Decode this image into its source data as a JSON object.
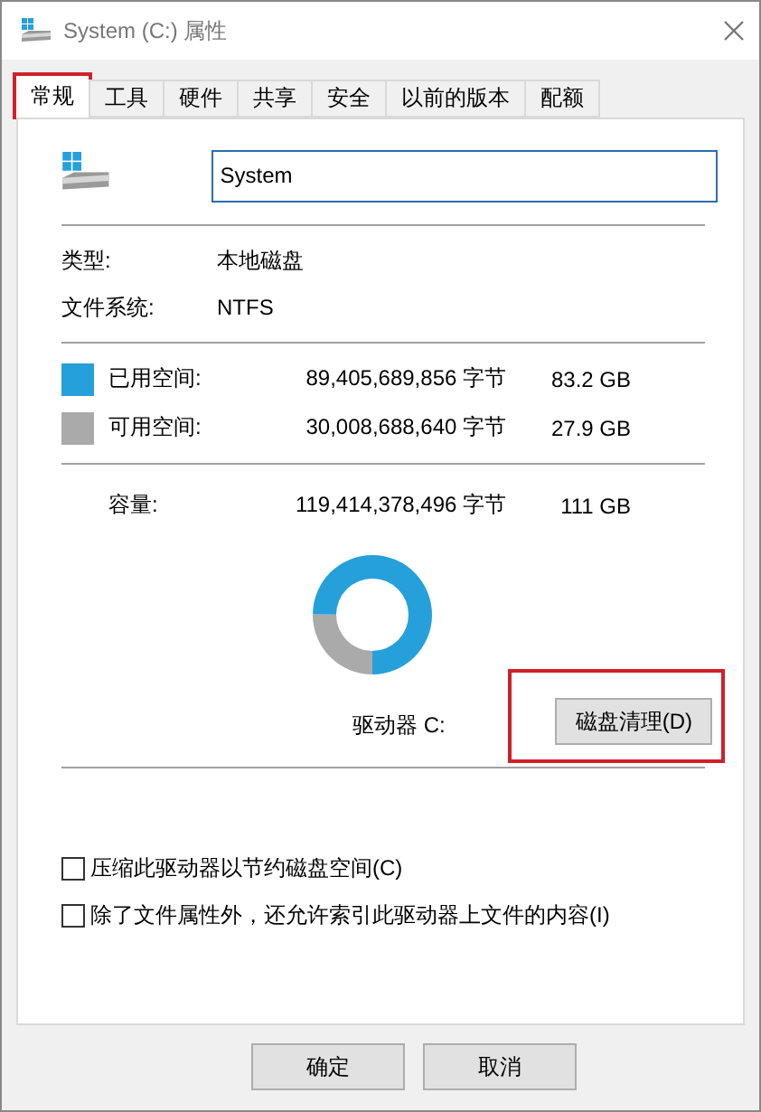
{
  "window": {
    "title": "System (C:) 属性"
  },
  "tabs": [
    {
      "label": "常规",
      "selected": true,
      "highlighted": true
    },
    {
      "label": "工具",
      "selected": false,
      "highlighted": false
    },
    {
      "label": "硬件",
      "selected": false,
      "highlighted": false
    },
    {
      "label": "共享",
      "selected": false,
      "highlighted": false
    },
    {
      "label": "安全",
      "selected": false,
      "highlighted": false
    },
    {
      "label": "以前的版本",
      "selected": false,
      "highlighted": false
    },
    {
      "label": "配额",
      "selected": false,
      "highlighted": false
    }
  ],
  "name_field": {
    "value": "System"
  },
  "info": [
    {
      "label": "类型:",
      "value": "本地磁盘"
    },
    {
      "label": "文件系统:",
      "value": "NTFS"
    }
  ],
  "space": [
    {
      "label": "已用空间:",
      "bytes": "89,405,689,856 字节",
      "size": "83.2 GB",
      "color": "#26a0da"
    },
    {
      "label": "可用空间:",
      "bytes": "30,008,688,640 字节",
      "size": "27.9 GB",
      "color": "#aaaaaa"
    }
  ],
  "capacity": {
    "label": "容量:",
    "bytes": "119,414,378,496 字节",
    "size": "111 GB"
  },
  "chart_data": {
    "type": "donut",
    "values": [
      74.9,
      25.1
    ]
  },
  "drive_label": "驱动器 C:",
  "cleanup_button": {
    "label": "磁盘清理(D)",
    "highlighted": true
  },
  "options": [
    {
      "label": "压缩此驱动器以节约磁盘空间(C)",
      "checked": false
    },
    {
      "label": "除了文件属性外，还允许索引此驱动器上文件的内容(I)",
      "checked": false
    }
  ],
  "buttons": [
    "确定",
    "取消"
  ]
}
